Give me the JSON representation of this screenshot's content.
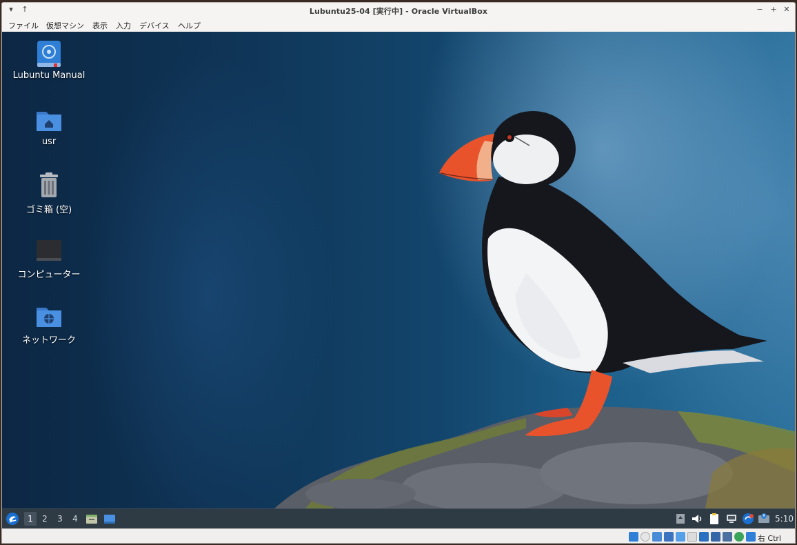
{
  "window": {
    "title": "Lubuntu25-04 [実行中] - Oracle VirtualBox",
    "controls": {
      "minimize": "−",
      "maximize": "+",
      "close": "✕",
      "menu": "▾",
      "pin": "↑"
    }
  },
  "menubar": {
    "items": [
      "ファイル",
      "仮想マシン",
      "表示",
      "入力",
      "デバイス",
      "ヘルプ"
    ]
  },
  "desktop": {
    "icons": [
      {
        "label": "Lubuntu Manual",
        "icon": "manual-book-icon"
      },
      {
        "label": "usr",
        "icon": "home-folder-icon"
      },
      {
        "label": "ゴミ箱 (空)",
        "icon": "trash-icon"
      },
      {
        "label": "コンピューター",
        "icon": "computer-icon"
      },
      {
        "label": "ネットワーク",
        "icon": "network-folder-icon"
      }
    ]
  },
  "panel": {
    "workspaces": [
      "1",
      "2",
      "3",
      "4"
    ],
    "active_workspace": "1",
    "clock": "5:10",
    "tray_icons": [
      "battery-icon",
      "volume-icon",
      "clipboard-icon",
      "network-icon",
      "update-icon",
      "notification-icon"
    ]
  },
  "statusbar": {
    "host_key": "右 Ctrl",
    "icons": [
      "hdd-icon",
      "optical-icon",
      "audio-icon",
      "network-adapter-icon",
      "usb-icon",
      "shared-folder-icon",
      "display-icon",
      "recording-icon",
      "cpu-icon",
      "arrow-icon",
      "mouse-icon"
    ]
  },
  "colors": {
    "panel": "#2e3a44",
    "folder_blue": "#4a90e2",
    "accent_orange": "#e8532b"
  }
}
